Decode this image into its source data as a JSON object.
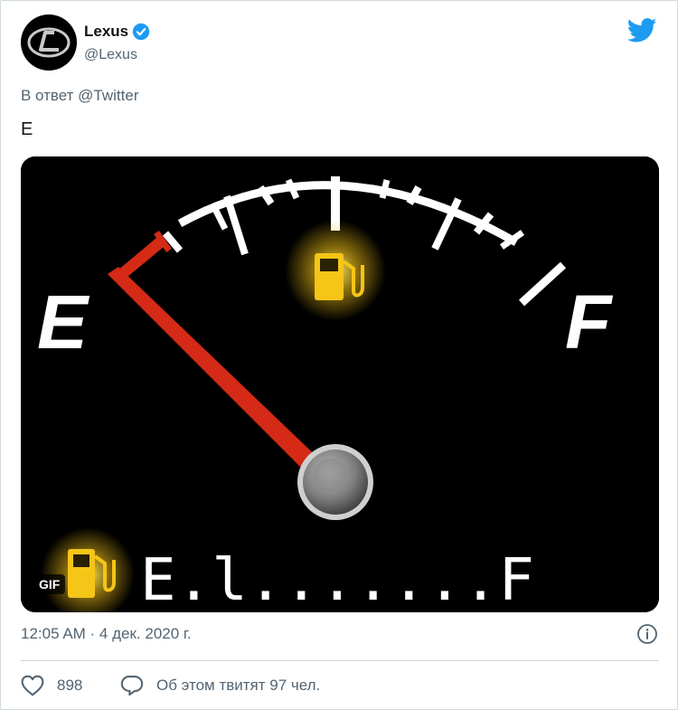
{
  "author": {
    "display_name": "Lexus",
    "handle": "@Lexus",
    "verified": true,
    "avatar_icon": "lexus-logo-icon"
  },
  "brand_icon": "twitter-bird-icon",
  "reply_to": "В ответ @Twitter",
  "tweet_text": "E",
  "media": {
    "badge": "GIF",
    "gauge_left_label": "E",
    "gauge_right_label": "F",
    "digital_readout": "E.l.......F",
    "warning_icon": "fuel-pump-icon",
    "needle_color": "#d42a16",
    "warning_color": "#f5c518"
  },
  "timestamp": "12:05 AM · 4 дек. 2020 г.",
  "likes_count": "898",
  "reply_label": "Об этом твитят 97 чел.",
  "colors": {
    "accent": "#1d9bf0",
    "text": "#0f1419",
    "secondary": "#536471"
  }
}
